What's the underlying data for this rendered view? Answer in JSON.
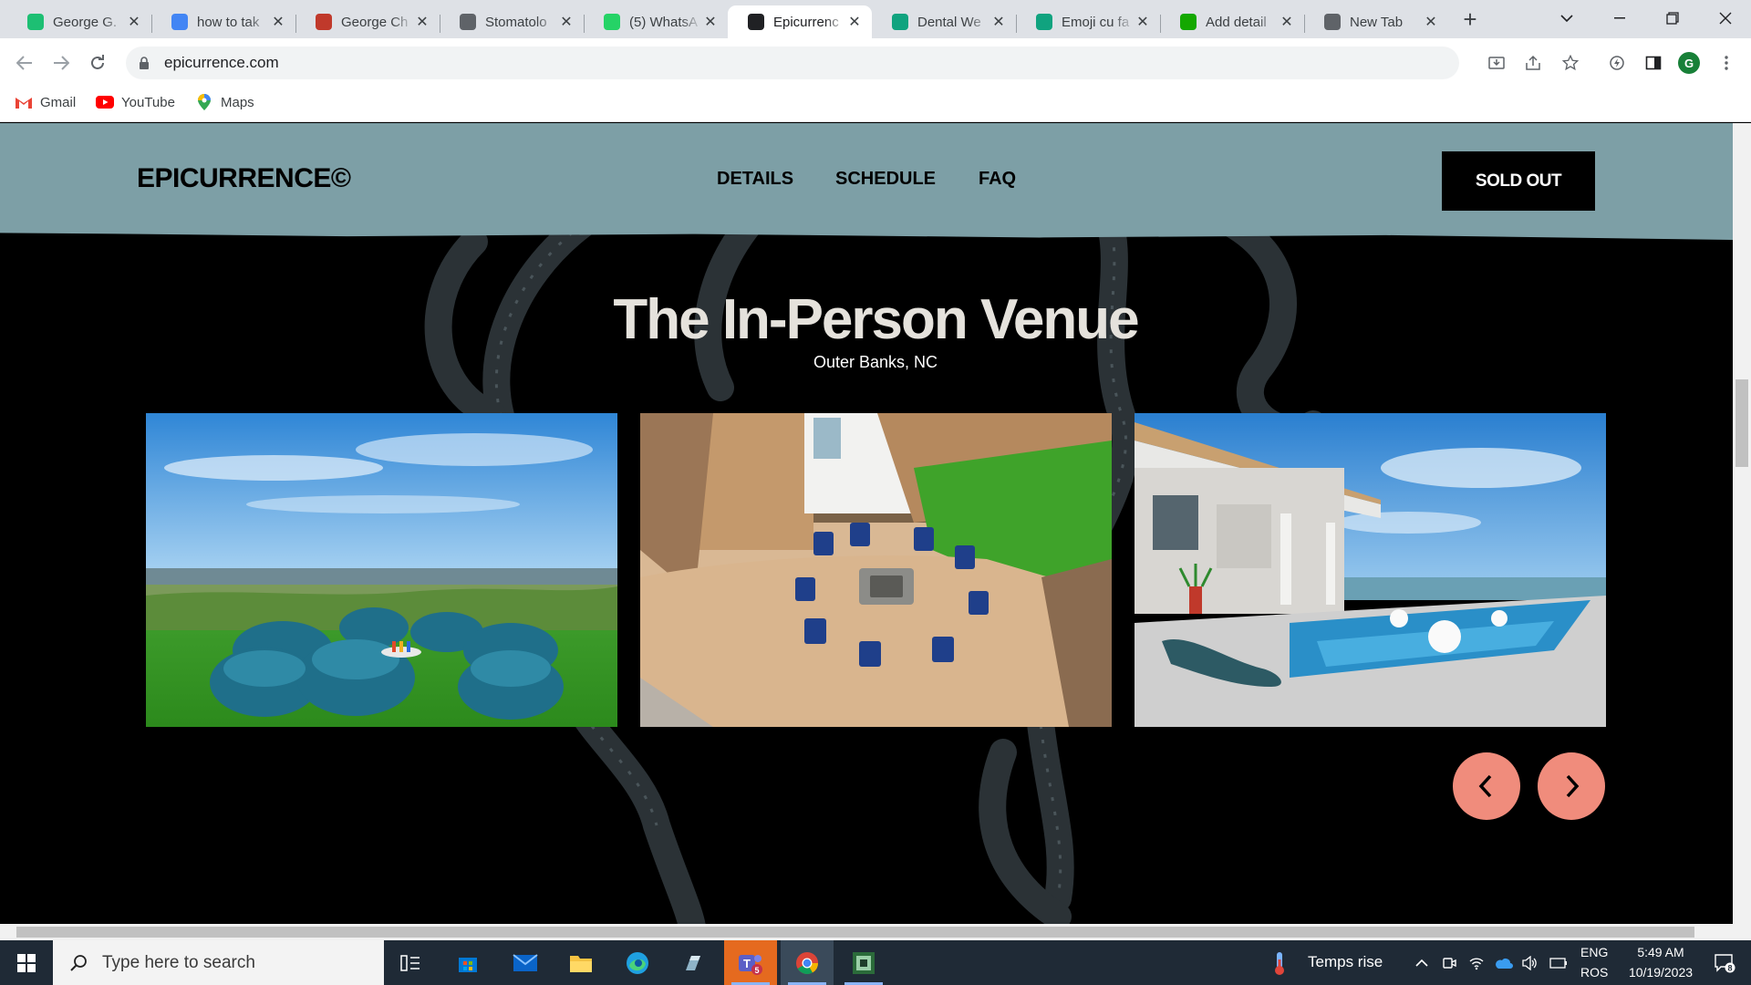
{
  "browser": {
    "tabs": [
      {
        "title": "George G.",
        "favicon": "fiverr-bird-icon",
        "color": "#1dbf73"
      },
      {
        "title": "how to tak",
        "favicon": "google-icon",
        "color": "#4285f4"
      },
      {
        "title": "George Ch",
        "favicon": "gc-icon",
        "color": "#c0392b"
      },
      {
        "title": "Stomatolo",
        "favicon": "w-logo-icon",
        "color": "#5f6368"
      },
      {
        "title": "(5) WhatsA",
        "favicon": "whatsapp-icon",
        "color": "#25d366"
      },
      {
        "title": "Epicurrenc",
        "favicon": "epicurrence-icon",
        "color": "#202124",
        "active": true
      },
      {
        "title": "Dental We",
        "favicon": "chatgpt-icon",
        "color": "#10a37f"
      },
      {
        "title": "Emoji cu fa",
        "favicon": "chatgpt-icon",
        "color": "#10a37f"
      },
      {
        "title": "Add detail",
        "favicon": "upwork-icon",
        "color": "#14a800"
      },
      {
        "title": "New Tab",
        "favicon": "chrome-icon",
        "color": "#5f6368"
      }
    ],
    "url": "epicurrence.com",
    "profile_initial": "G",
    "bookmarks": [
      {
        "label": "Gmail",
        "icon": "gmail-icon"
      },
      {
        "label": "YouTube",
        "icon": "youtube-icon"
      },
      {
        "label": "Maps",
        "icon": "maps-pin-icon"
      }
    ]
  },
  "site": {
    "logo": "EPICURRENCE©",
    "nav": [
      "DETAILS",
      "SCHEDULE",
      "FAQ"
    ],
    "cta": "SOLD OUT",
    "venue_title": "The In-Person Venue",
    "venue_location": "Outer Banks, NC",
    "photos": [
      "lawn-lounge-chairs-photo",
      "patio-firepit-photo",
      "pool-deck-photo"
    ],
    "colors": {
      "header_bg": "#7d9fa6",
      "arrow_bg": "#f08c7c",
      "title": "#e5e2dc"
    }
  },
  "taskbar": {
    "search_placeholder": "Type here to search",
    "weather": "Temps rise",
    "language": "ENG",
    "layout": "ROS",
    "time": "5:49 AM",
    "date": "10/19/2023",
    "teams_badge": "5",
    "notifications": "8"
  }
}
